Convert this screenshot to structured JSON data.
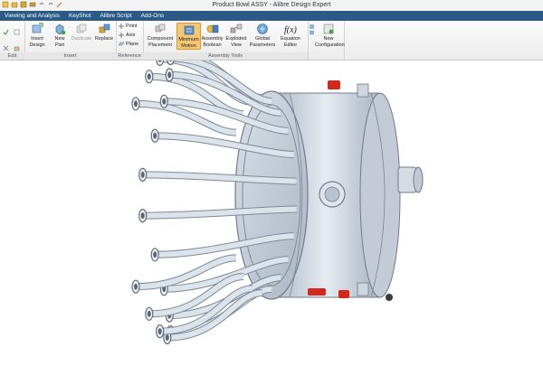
{
  "window": {
    "title": "Product Bowl ASSY - Alibre Design Expert"
  },
  "tabs": [
    {
      "label": "Viewing and Analysis"
    },
    {
      "label": "KeyShot"
    },
    {
      "label": "Alibre Script"
    },
    {
      "label": "Add-Ons"
    }
  ],
  "ribbon": {
    "groups": {
      "edit": "Edit",
      "insert": "Insert",
      "reference": "Reference",
      "assembly_tools": "Assembly Tools"
    },
    "insert_design": {
      "line1": "Insert",
      "line2": "Design"
    },
    "new_part": {
      "line1": "New",
      "line2": "Part"
    },
    "duplicate": "Duplicate",
    "replace": "Replace",
    "reference_items": [
      "Point",
      "Axis",
      "Plane"
    ],
    "component_placement": {
      "line1": "Component",
      "line2": "Placement"
    },
    "minimum_motion": {
      "line1": "Minimum",
      "line2": "Motion"
    },
    "assembly_boolean": {
      "line1": "Assembly",
      "line2": "Boolean"
    },
    "exploded_view": {
      "line1": "Exploded",
      "line2": "View"
    },
    "global_parameters": {
      "line1": "Global",
      "line2": "Parameters"
    },
    "equation_editor": {
      "line1": "Equation",
      "line2": "Editor"
    },
    "new_configuration": {
      "line1": "New",
      "line2": "Configuration"
    }
  },
  "colors": {
    "tab_bar": "#2b5a86",
    "active_tool": "#f6c673",
    "model_body": "#c9d3dd",
    "clamp_red": "#d2281e"
  },
  "icons": {
    "equation_symbol": "f(x)"
  }
}
